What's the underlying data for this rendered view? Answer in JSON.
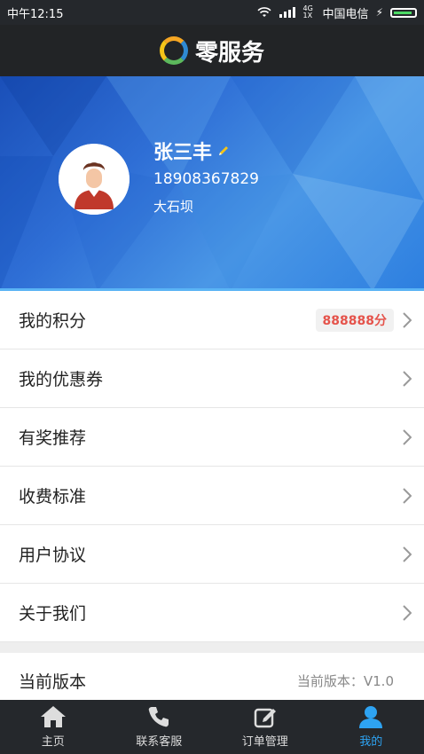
{
  "status_bar": {
    "time": "中午12:15",
    "carrier": "中国电信",
    "network": "4G 1X"
  },
  "app": {
    "title": "零服务"
  },
  "profile": {
    "name": "张三丰",
    "phone": "18908367829",
    "location": "大石坝"
  },
  "menu": {
    "items": [
      {
        "label": "我的积分",
        "badge": "888888分"
      },
      {
        "label": "我的优惠券"
      },
      {
        "label": "有奖推荐"
      },
      {
        "label": "收费标准"
      },
      {
        "label": "用户协议"
      },
      {
        "label": "关于我们"
      }
    ],
    "version_label": "当前版本",
    "version_value": "当前版本：V1.0"
  },
  "tabs": [
    {
      "label": "主页",
      "icon": "home-icon"
    },
    {
      "label": "联系客服",
      "icon": "phone-icon"
    },
    {
      "label": "订单管理",
      "icon": "edit-icon"
    },
    {
      "label": "我的",
      "icon": "user-icon"
    }
  ],
  "colors": {
    "accent": "#2ea3f2",
    "badge_text": "#e5534b",
    "header_bg": "#222426"
  }
}
